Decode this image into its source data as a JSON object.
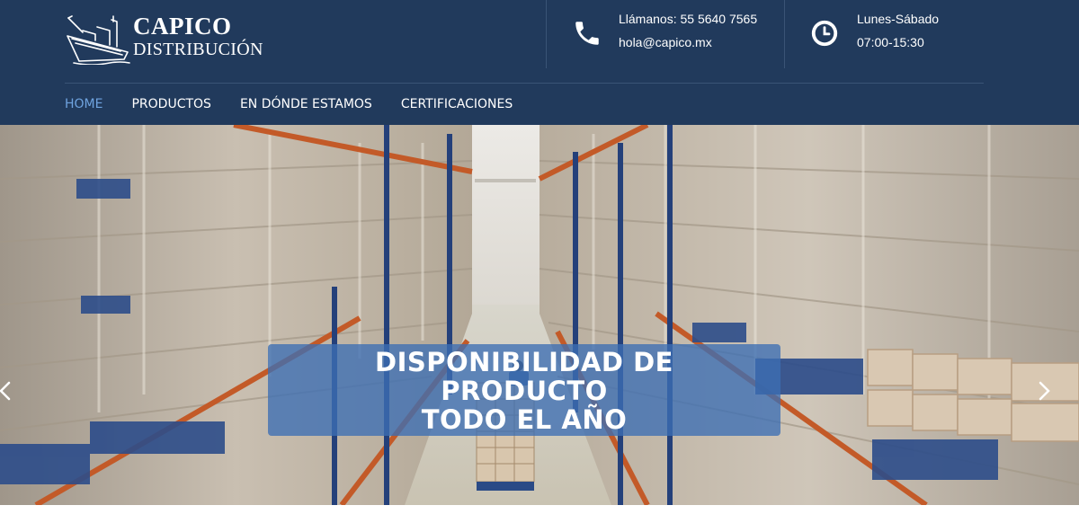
{
  "brand": {
    "line1": "CAPICO",
    "line2": "DISTRIBUCIÓN"
  },
  "contact": {
    "phone_label": "Llámanos: 55 5640 7565",
    "email": "hola@capico.mx",
    "days": "Lunes-Sábado",
    "hours": "07:00-15:30"
  },
  "nav": {
    "items": [
      {
        "label": "HOME",
        "active": true
      },
      {
        "label": "PRODUCTOS",
        "active": false
      },
      {
        "label": "EN DÓNDE ESTAMOS",
        "active": false
      },
      {
        "label": "CERTIFICACIONES",
        "active": false
      }
    ]
  },
  "hero": {
    "lines": [
      "DISPONIBILIDAD DE",
      "PRODUCTO",
      "TODO EL AÑO"
    ]
  },
  "icons": {
    "phone": "phone-icon",
    "clock": "clock-icon",
    "prev": "chevron-left-icon",
    "next": "chevron-right-icon"
  },
  "colors": {
    "header_bg": "#213a5c",
    "nav_active": "#6fa3df",
    "overlay": "#3c6eb4"
  }
}
